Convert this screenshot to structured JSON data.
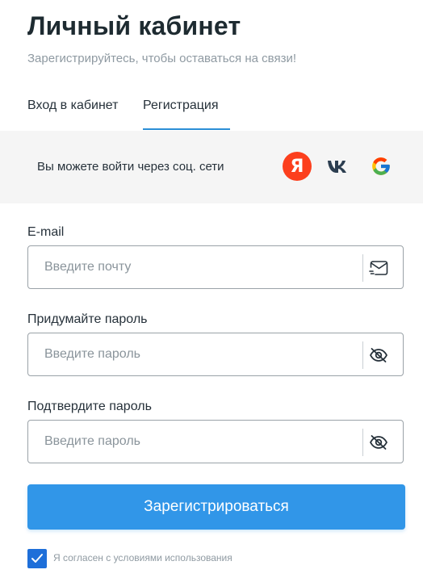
{
  "header": {
    "title": "Личный кабинет",
    "subtitle": "Зарегистрируйтесь, чтобы оставаться на связи!"
  },
  "tabs": {
    "login": "Вход в кабинет",
    "register": "Регистрация",
    "active": "register"
  },
  "social": {
    "text": "Вы можете войти через соц. сети",
    "providers": [
      {
        "name": "yandex",
        "icon": "yandex-icon",
        "glyph": "Я",
        "color": "#fc3f1d"
      },
      {
        "name": "vk",
        "icon": "vk-icon",
        "color": "#2c3e50"
      },
      {
        "name": "google",
        "icon": "google-icon"
      }
    ]
  },
  "form": {
    "email": {
      "label": "E-mail",
      "placeholder": "Введите почту",
      "icon": "mail-icon"
    },
    "password": {
      "label": "Придумайте пароль",
      "placeholder": "Введите пароль",
      "icon": "eye-off-icon"
    },
    "confirm": {
      "label": "Подтвердите пароль",
      "placeholder": "Введите пароль",
      "icon": "eye-off-icon"
    },
    "submit_label": "Зарегистрироваться",
    "agree": {
      "checked": true,
      "label": "Я согласен с условиями использования"
    }
  },
  "colors": {
    "accent": "#3196e8",
    "tab_underline": "#2b8fd6",
    "checkbox": "#1e6fd9",
    "social_bg": "#f5f5f5"
  }
}
